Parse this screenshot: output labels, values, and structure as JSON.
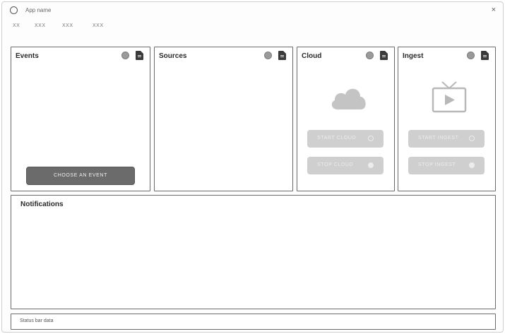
{
  "window": {
    "app_name": "App name",
    "close_symbol": "×"
  },
  "menu": {
    "items": [
      "XX",
      "XXX",
      "XXX",
      "XXX"
    ]
  },
  "events": {
    "title": "Events",
    "choose_button": "CHOOSE AN EVENT"
  },
  "sources": {
    "title": "Sources"
  },
  "cloud": {
    "title": "Cloud",
    "icon": "cloud-icon",
    "start_button": "START CLOUD",
    "stop_button": "STOP CLOUD"
  },
  "ingest": {
    "title": "Ingest",
    "icon": "tv-play-icon",
    "start_button": "START INGEST",
    "stop_button": "STOP INGEST"
  },
  "notifications": {
    "title": "Notifications"
  },
  "statusbar": {
    "text": "Status bar data"
  },
  "colors": {
    "panel_border": "#6a6a6a",
    "dark_button": "#6b6b6b",
    "disabled_button": "#cfcfcf",
    "icon_gray": "#c4c4c4"
  }
}
